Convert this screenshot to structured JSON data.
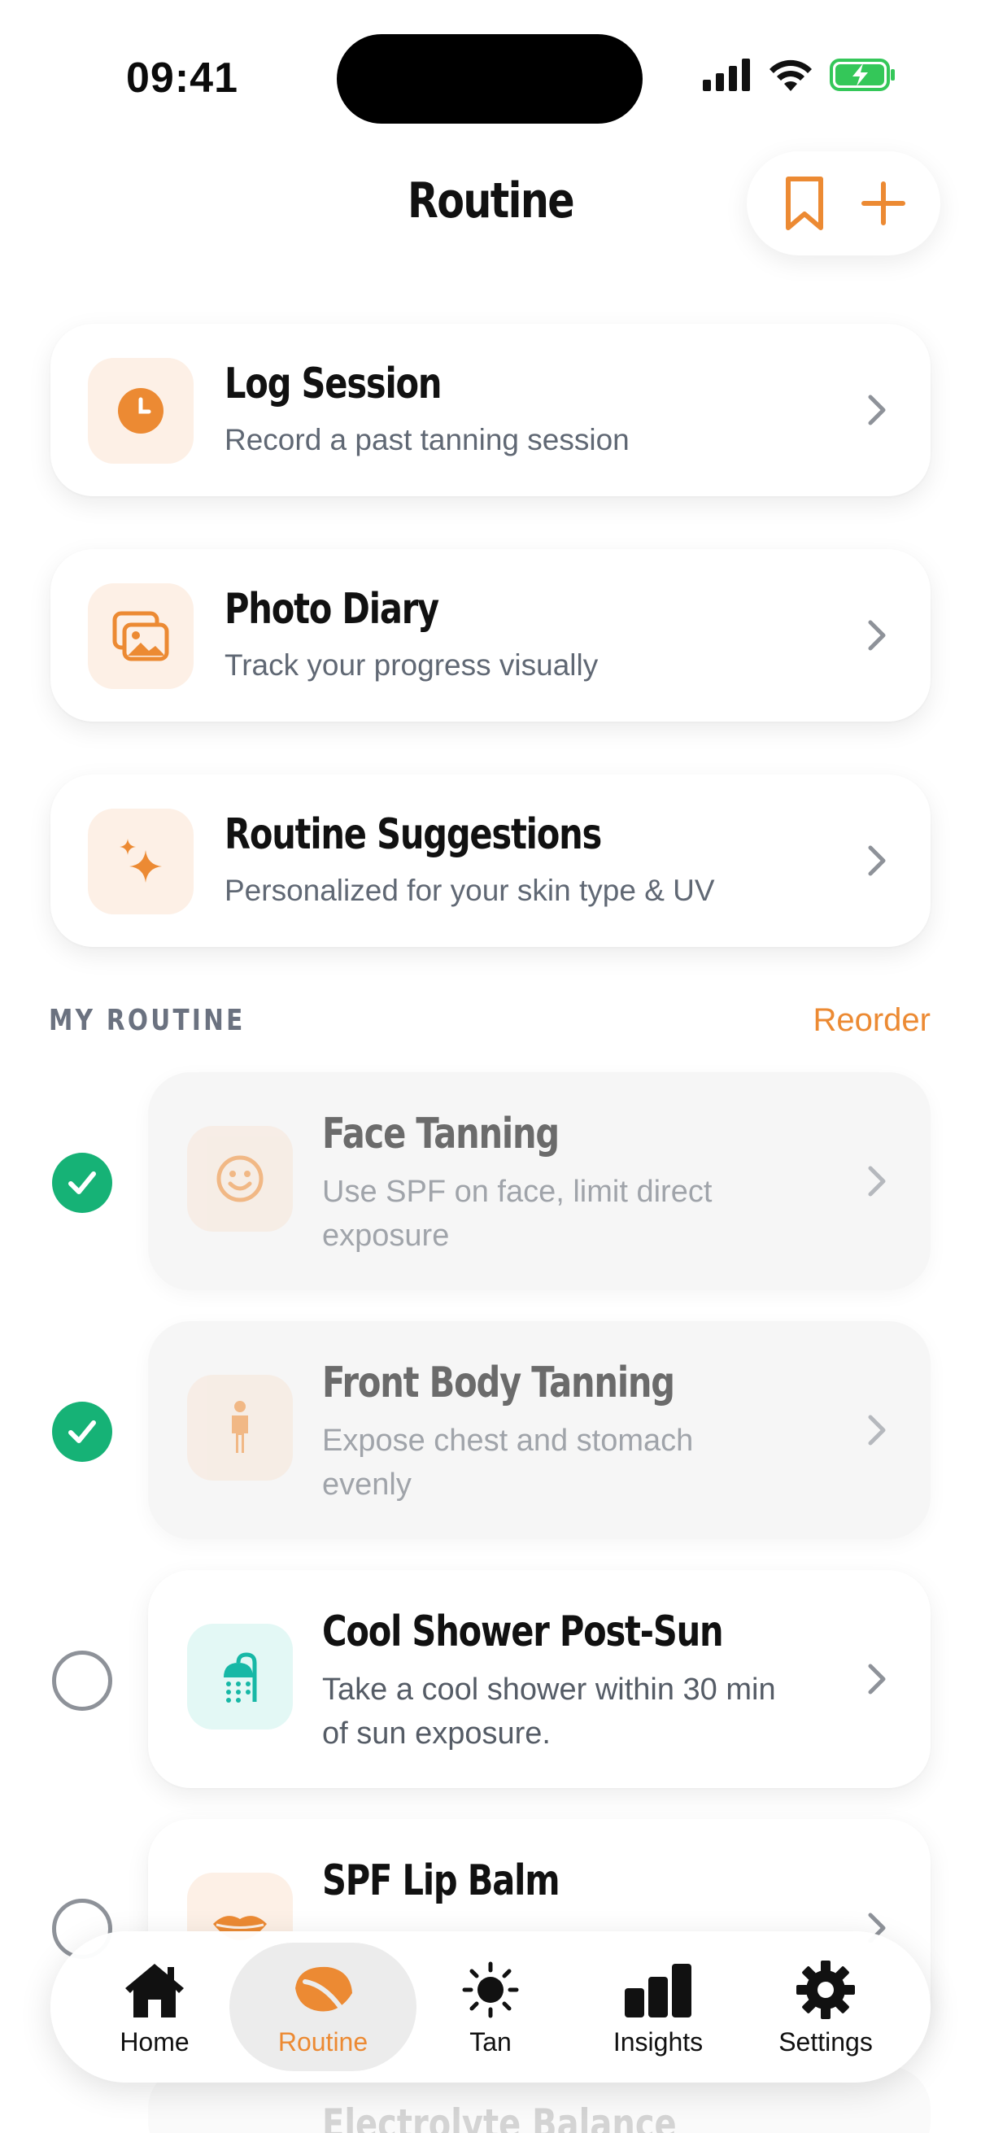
{
  "status_bar": {
    "time": "09:41"
  },
  "header": {
    "title": "Routine"
  },
  "action_cards": [
    {
      "title": "Log Session",
      "subtitle": "Record a past tanning session",
      "icon": "clock-icon"
    },
    {
      "title": "Photo Diary",
      "subtitle": "Track your progress visually",
      "icon": "photos-icon"
    },
    {
      "title": "Routine Suggestions",
      "subtitle": "Personalized for your skin type & UV",
      "icon": "sparkles-icon"
    }
  ],
  "section": {
    "label": "MY ROUTINE",
    "reorder": "Reorder"
  },
  "routine_items": [
    {
      "title": "Face Tanning",
      "subtitle": "Use SPF on face, limit direct exposure",
      "done": true,
      "icon": "smiley-face-icon"
    },
    {
      "title": "Front Body Tanning",
      "subtitle": "Expose chest and stomach evenly",
      "done": true,
      "icon": "person-icon"
    },
    {
      "title": "Cool Shower Post-Sun",
      "subtitle": "Take a cool shower within 30 min of sun exposure.",
      "done": false,
      "icon": "shower-icon"
    },
    {
      "title": "SPF Lip Balm",
      "subtitle": "",
      "done": false,
      "icon": "lips-icon"
    },
    {
      "title": "Electrolyte Balance",
      "subtitle": "",
      "done": false,
      "icon": ""
    }
  ],
  "tabs": [
    {
      "label": "Home",
      "icon": "house-icon",
      "active": false
    },
    {
      "label": "Routine",
      "icon": "leaf-icon",
      "active": true
    },
    {
      "label": "Tan",
      "icon": "sun-icon",
      "active": false
    },
    {
      "label": "Insights",
      "icon": "bar-chart-icon",
      "active": false
    },
    {
      "label": "Settings",
      "icon": "gear-icon",
      "active": false
    }
  ],
  "colors": {
    "accent": "#ec8a33",
    "success": "#16b276",
    "teal": "#17b8a6"
  }
}
